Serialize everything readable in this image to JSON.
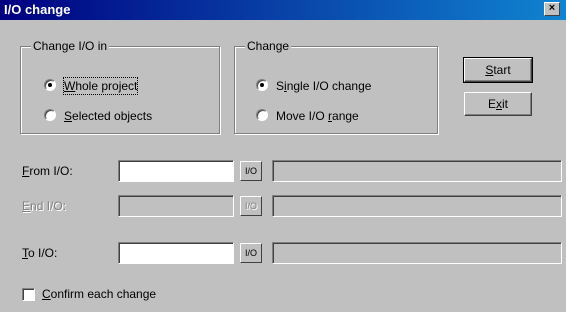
{
  "title": "I/O change",
  "close_glyph": "×",
  "group_change_in": {
    "legend": "Change I/O in",
    "options": [
      {
        "label": "Whole project",
        "selected": true
      },
      {
        "label": "Selected objects",
        "selected": false
      }
    ]
  },
  "group_change": {
    "legend": "Change",
    "options": [
      {
        "label": "Single I/O change",
        "selected": true
      },
      {
        "label": "Move I/O range",
        "selected": false
      }
    ]
  },
  "buttons": {
    "start": "Start",
    "exit": "Exit"
  },
  "fields": [
    {
      "label": "From I/O:",
      "io_label": "I/O",
      "value": "",
      "enabled": true
    },
    {
      "label": "End I/O:",
      "io_label": "I/O",
      "value": "",
      "enabled": false
    },
    {
      "label": "To I/O:",
      "io_label": "I/O",
      "value": "",
      "enabled": true
    }
  ],
  "confirm": {
    "label": "Confirm each change",
    "checked": false
  },
  "colors": {
    "face": "#c0c0c0",
    "title_start": "#000080",
    "title_end": "#1084d0"
  }
}
